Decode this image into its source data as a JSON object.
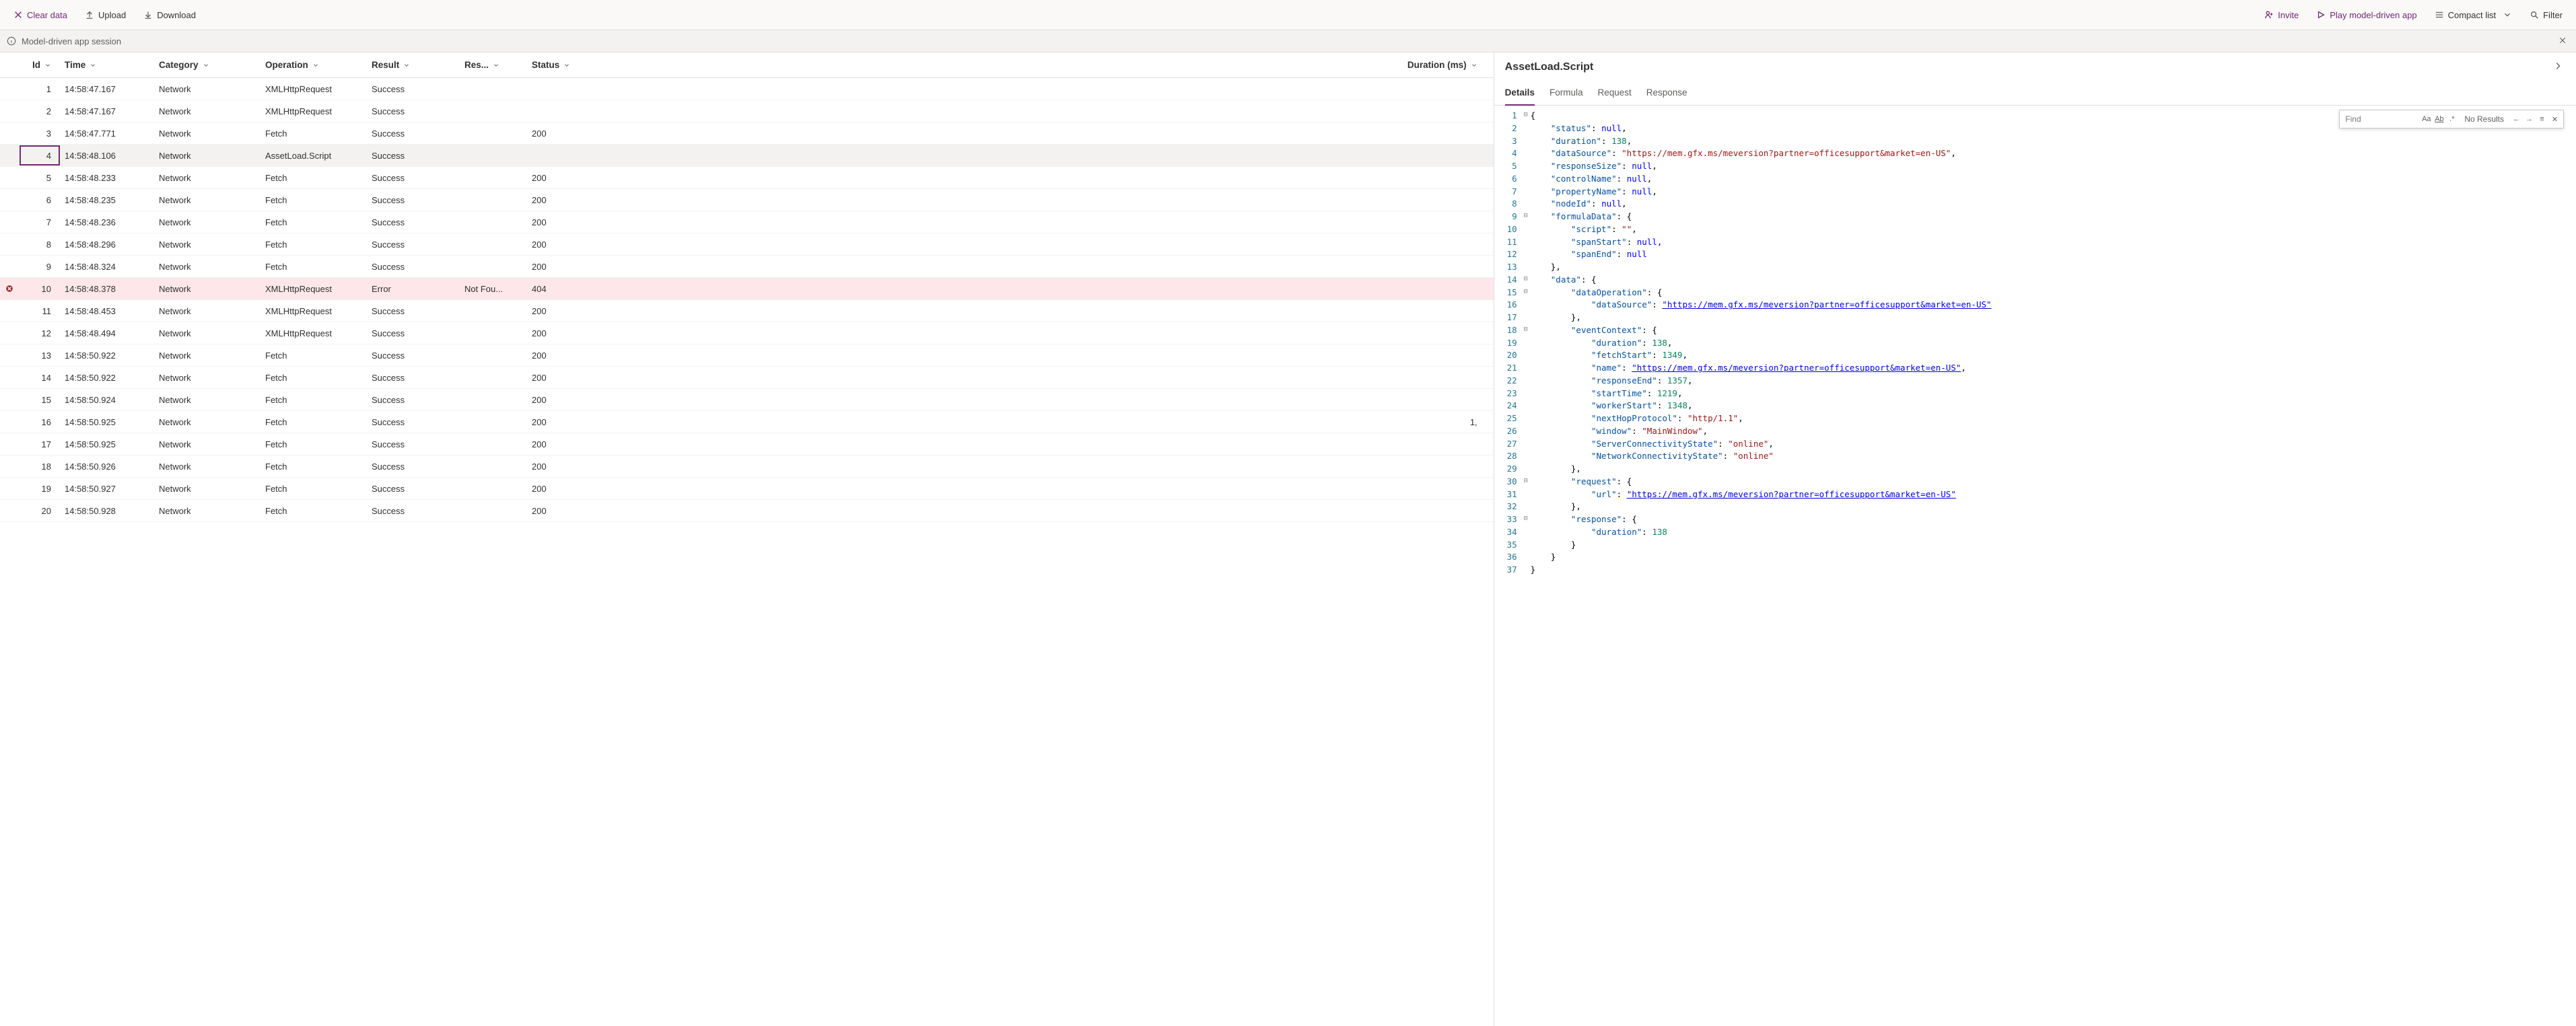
{
  "toolbar": {
    "clear": "Clear data",
    "upload": "Upload",
    "download": "Download",
    "invite": "Invite",
    "play": "Play model-driven app",
    "compact": "Compact list",
    "filter": "Filter"
  },
  "session": {
    "label": "Model-driven app session"
  },
  "columns": {
    "id": "Id",
    "time": "Time",
    "category": "Category",
    "operation": "Operation",
    "result": "Result",
    "resinfo": "Res...",
    "status": "Status",
    "duration": "Duration (ms)"
  },
  "rows": [
    {
      "id": "1",
      "time": "14:58:47.167",
      "cat": "Network",
      "op": "XMLHttpRequest",
      "res": "Success",
      "resinfo": "",
      "status": "",
      "dur": ""
    },
    {
      "id": "2",
      "time": "14:58:47.167",
      "cat": "Network",
      "op": "XMLHttpRequest",
      "res": "Success",
      "resinfo": "",
      "status": "",
      "dur": ""
    },
    {
      "id": "3",
      "time": "14:58:47.771",
      "cat": "Network",
      "op": "Fetch",
      "res": "Success",
      "resinfo": "",
      "status": "200",
      "dur": ""
    },
    {
      "id": "4",
      "time": "14:58:48.106",
      "cat": "Network",
      "op": "AssetLoad.Script",
      "res": "Success",
      "resinfo": "",
      "status": "",
      "dur": "",
      "selected": true
    },
    {
      "id": "5",
      "time": "14:58:48.233",
      "cat": "Network",
      "op": "Fetch",
      "res": "Success",
      "resinfo": "",
      "status": "200",
      "dur": ""
    },
    {
      "id": "6",
      "time": "14:58:48.235",
      "cat": "Network",
      "op": "Fetch",
      "res": "Success",
      "resinfo": "",
      "status": "200",
      "dur": ""
    },
    {
      "id": "7",
      "time": "14:58:48.236",
      "cat": "Network",
      "op": "Fetch",
      "res": "Success",
      "resinfo": "",
      "status": "200",
      "dur": ""
    },
    {
      "id": "8",
      "time": "14:58:48.296",
      "cat": "Network",
      "op": "Fetch",
      "res": "Success",
      "resinfo": "",
      "status": "200",
      "dur": ""
    },
    {
      "id": "9",
      "time": "14:58:48.324",
      "cat": "Network",
      "op": "Fetch",
      "res": "Success",
      "resinfo": "",
      "status": "200",
      "dur": ""
    },
    {
      "id": "10",
      "time": "14:58:48.378",
      "cat": "Network",
      "op": "XMLHttpRequest",
      "res": "Error",
      "resinfo": "Not Fou...",
      "status": "404",
      "dur": "",
      "error": true
    },
    {
      "id": "11",
      "time": "14:58:48.453",
      "cat": "Network",
      "op": "XMLHttpRequest",
      "res": "Success",
      "resinfo": "",
      "status": "200",
      "dur": ""
    },
    {
      "id": "12",
      "time": "14:58:48.494",
      "cat": "Network",
      "op": "XMLHttpRequest",
      "res": "Success",
      "resinfo": "",
      "status": "200",
      "dur": ""
    },
    {
      "id": "13",
      "time": "14:58:50.922",
      "cat": "Network",
      "op": "Fetch",
      "res": "Success",
      "resinfo": "",
      "status": "200",
      "dur": ""
    },
    {
      "id": "14",
      "time": "14:58:50.922",
      "cat": "Network",
      "op": "Fetch",
      "res": "Success",
      "resinfo": "",
      "status": "200",
      "dur": ""
    },
    {
      "id": "15",
      "time": "14:58:50.924",
      "cat": "Network",
      "op": "Fetch",
      "res": "Success",
      "resinfo": "",
      "status": "200",
      "dur": ""
    },
    {
      "id": "16",
      "time": "14:58:50.925",
      "cat": "Network",
      "op": "Fetch",
      "res": "Success",
      "resinfo": "",
      "status": "200",
      "dur": "1,"
    },
    {
      "id": "17",
      "time": "14:58:50.925",
      "cat": "Network",
      "op": "Fetch",
      "res": "Success",
      "resinfo": "",
      "status": "200",
      "dur": ""
    },
    {
      "id": "18",
      "time": "14:58:50.926",
      "cat": "Network",
      "op": "Fetch",
      "res": "Success",
      "resinfo": "",
      "status": "200",
      "dur": ""
    },
    {
      "id": "19",
      "time": "14:58:50.927",
      "cat": "Network",
      "op": "Fetch",
      "res": "Success",
      "resinfo": "",
      "status": "200",
      "dur": ""
    },
    {
      "id": "20",
      "time": "14:58:50.928",
      "cat": "Network",
      "op": "Fetch",
      "res": "Success",
      "resinfo": "",
      "status": "200",
      "dur": ""
    }
  ],
  "details": {
    "title": "AssetLoad.Script",
    "tabs": {
      "details": "Details",
      "formula": "Formula",
      "request": "Request",
      "response": "Response"
    },
    "find": {
      "placeholder": "Find",
      "no_results": "No Results"
    }
  },
  "code": [
    {
      "n": 1,
      "fold": "-",
      "t": [
        [
          "pun",
          "{"
        ]
      ]
    },
    {
      "n": 2,
      "t": [
        [
          "pun",
          "    "
        ],
        [
          "key",
          "\"status\""
        ],
        [
          "pun",
          ": "
        ],
        [
          "null",
          "null"
        ],
        [
          "pun",
          ","
        ]
      ]
    },
    {
      "n": 3,
      "t": [
        [
          "pun",
          "    "
        ],
        [
          "key",
          "\"duration\""
        ],
        [
          "pun",
          ": "
        ],
        [
          "num",
          "138"
        ],
        [
          "pun",
          ","
        ]
      ]
    },
    {
      "n": 4,
      "t": [
        [
          "pun",
          "    "
        ],
        [
          "key",
          "\"dataSource\""
        ],
        [
          "pun",
          ": "
        ],
        [
          "str",
          "\"https://mem.gfx.ms/meversion?partner=officesupport&market=en-US\""
        ],
        [
          "pun",
          ","
        ]
      ]
    },
    {
      "n": 5,
      "t": [
        [
          "pun",
          "    "
        ],
        [
          "key",
          "\"responseSize\""
        ],
        [
          "pun",
          ": "
        ],
        [
          "null",
          "null"
        ],
        [
          "pun",
          ","
        ]
      ]
    },
    {
      "n": 6,
      "t": [
        [
          "pun",
          "    "
        ],
        [
          "key",
          "\"controlName\""
        ],
        [
          "pun",
          ": "
        ],
        [
          "null",
          "null"
        ],
        [
          "pun",
          ","
        ]
      ]
    },
    {
      "n": 7,
      "t": [
        [
          "pun",
          "    "
        ],
        [
          "key",
          "\"propertyName\""
        ],
        [
          "pun",
          ": "
        ],
        [
          "null",
          "null"
        ],
        [
          "pun",
          ","
        ]
      ]
    },
    {
      "n": 8,
      "t": [
        [
          "pun",
          "    "
        ],
        [
          "key",
          "\"nodeId\""
        ],
        [
          "pun",
          ": "
        ],
        [
          "null",
          "null"
        ],
        [
          "pun",
          ","
        ]
      ]
    },
    {
      "n": 9,
      "fold": "-",
      "t": [
        [
          "pun",
          "    "
        ],
        [
          "key",
          "\"formulaData\""
        ],
        [
          "pun",
          ": {"
        ]
      ]
    },
    {
      "n": 10,
      "t": [
        [
          "pun",
          "        "
        ],
        [
          "key",
          "\"script\""
        ],
        [
          "pun",
          ": "
        ],
        [
          "str",
          "\"\""
        ],
        [
          "pun",
          ","
        ]
      ]
    },
    {
      "n": 11,
      "t": [
        [
          "pun",
          "        "
        ],
        [
          "key",
          "\"spanStart\""
        ],
        [
          "pun",
          ": "
        ],
        [
          "null",
          "null"
        ],
        [
          "pun",
          ","
        ]
      ]
    },
    {
      "n": 12,
      "t": [
        [
          "pun",
          "        "
        ],
        [
          "key",
          "\"spanEnd\""
        ],
        [
          "pun",
          ": "
        ],
        [
          "null",
          "null"
        ]
      ]
    },
    {
      "n": 13,
      "t": [
        [
          "pun",
          "    },"
        ]
      ]
    },
    {
      "n": 14,
      "fold": "-",
      "t": [
        [
          "pun",
          "    "
        ],
        [
          "key",
          "\"data\""
        ],
        [
          "pun",
          ": {"
        ]
      ]
    },
    {
      "n": 15,
      "fold": "-",
      "t": [
        [
          "pun",
          "        "
        ],
        [
          "key",
          "\"dataOperation\""
        ],
        [
          "pun",
          ": {"
        ]
      ]
    },
    {
      "n": 16,
      "t": [
        [
          "pun",
          "            "
        ],
        [
          "key",
          "\"dataSource\""
        ],
        [
          "pun",
          ": "
        ],
        [
          "url",
          "\"https://mem.gfx.ms/meversion?partner=officesupport&market=en-US\""
        ]
      ]
    },
    {
      "n": 17,
      "t": [
        [
          "pun",
          "        },"
        ]
      ]
    },
    {
      "n": 18,
      "fold": "-",
      "t": [
        [
          "pun",
          "        "
        ],
        [
          "key",
          "\"eventContext\""
        ],
        [
          "pun",
          ": {"
        ]
      ]
    },
    {
      "n": 19,
      "t": [
        [
          "pun",
          "            "
        ],
        [
          "key",
          "\"duration\""
        ],
        [
          "pun",
          ": "
        ],
        [
          "num",
          "138"
        ],
        [
          "pun",
          ","
        ]
      ]
    },
    {
      "n": 20,
      "t": [
        [
          "pun",
          "            "
        ],
        [
          "key",
          "\"fetchStart\""
        ],
        [
          "pun",
          ": "
        ],
        [
          "num",
          "1349"
        ],
        [
          "pun",
          ","
        ]
      ]
    },
    {
      "n": 21,
      "t": [
        [
          "pun",
          "            "
        ],
        [
          "key",
          "\"name\""
        ],
        [
          "pun",
          ": "
        ],
        [
          "url",
          "\"https://mem.gfx.ms/meversion?partner=officesupport&market=en-US\""
        ],
        [
          "pun",
          ","
        ]
      ]
    },
    {
      "n": 22,
      "t": [
        [
          "pun",
          "            "
        ],
        [
          "key",
          "\"responseEnd\""
        ],
        [
          "pun",
          ": "
        ],
        [
          "num",
          "1357"
        ],
        [
          "pun",
          ","
        ]
      ]
    },
    {
      "n": 23,
      "t": [
        [
          "pun",
          "            "
        ],
        [
          "key",
          "\"startTime\""
        ],
        [
          "pun",
          ": "
        ],
        [
          "num",
          "1219"
        ],
        [
          "pun",
          ","
        ]
      ]
    },
    {
      "n": 24,
      "t": [
        [
          "pun",
          "            "
        ],
        [
          "key",
          "\"workerStart\""
        ],
        [
          "pun",
          ": "
        ],
        [
          "num",
          "1348"
        ],
        [
          "pun",
          ","
        ]
      ]
    },
    {
      "n": 25,
      "t": [
        [
          "pun",
          "            "
        ],
        [
          "key",
          "\"nextHopProtocol\""
        ],
        [
          "pun",
          ": "
        ],
        [
          "str",
          "\"http/1.1\""
        ],
        [
          "pun",
          ","
        ]
      ]
    },
    {
      "n": 26,
      "t": [
        [
          "pun",
          "            "
        ],
        [
          "key",
          "\"window\""
        ],
        [
          "pun",
          ": "
        ],
        [
          "str",
          "\"MainWindow\""
        ],
        [
          "pun",
          ","
        ]
      ]
    },
    {
      "n": 27,
      "t": [
        [
          "pun",
          "            "
        ],
        [
          "key",
          "\"ServerConnectivityState\""
        ],
        [
          "pun",
          ": "
        ],
        [
          "str",
          "\"online\""
        ],
        [
          "pun",
          ","
        ]
      ]
    },
    {
      "n": 28,
      "t": [
        [
          "pun",
          "            "
        ],
        [
          "key",
          "\"NetworkConnectivityState\""
        ],
        [
          "pun",
          ": "
        ],
        [
          "str",
          "\"online\""
        ]
      ]
    },
    {
      "n": 29,
      "t": [
        [
          "pun",
          "        },"
        ]
      ]
    },
    {
      "n": 30,
      "fold": "-",
      "t": [
        [
          "pun",
          "        "
        ],
        [
          "key",
          "\"request\""
        ],
        [
          "pun",
          ": {"
        ]
      ]
    },
    {
      "n": 31,
      "t": [
        [
          "pun",
          "            "
        ],
        [
          "key",
          "\"url\""
        ],
        [
          "pun",
          ": "
        ],
        [
          "url",
          "\"https://mem.gfx.ms/meversion?partner=officesupport&market=en-US\""
        ]
      ]
    },
    {
      "n": 32,
      "t": [
        [
          "pun",
          "        },"
        ]
      ]
    },
    {
      "n": 33,
      "fold": "-",
      "t": [
        [
          "pun",
          "        "
        ],
        [
          "key",
          "\"response\""
        ],
        [
          "pun",
          ": {"
        ]
      ]
    },
    {
      "n": 34,
      "t": [
        [
          "pun",
          "            "
        ],
        [
          "key",
          "\"duration\""
        ],
        [
          "pun",
          ": "
        ],
        [
          "num",
          "138"
        ]
      ]
    },
    {
      "n": 35,
      "t": [
        [
          "pun",
          "        }"
        ]
      ]
    },
    {
      "n": 36,
      "t": [
        [
          "pun",
          "    }"
        ]
      ]
    },
    {
      "n": 37,
      "t": [
        [
          "pun",
          "}"
        ]
      ]
    }
  ]
}
